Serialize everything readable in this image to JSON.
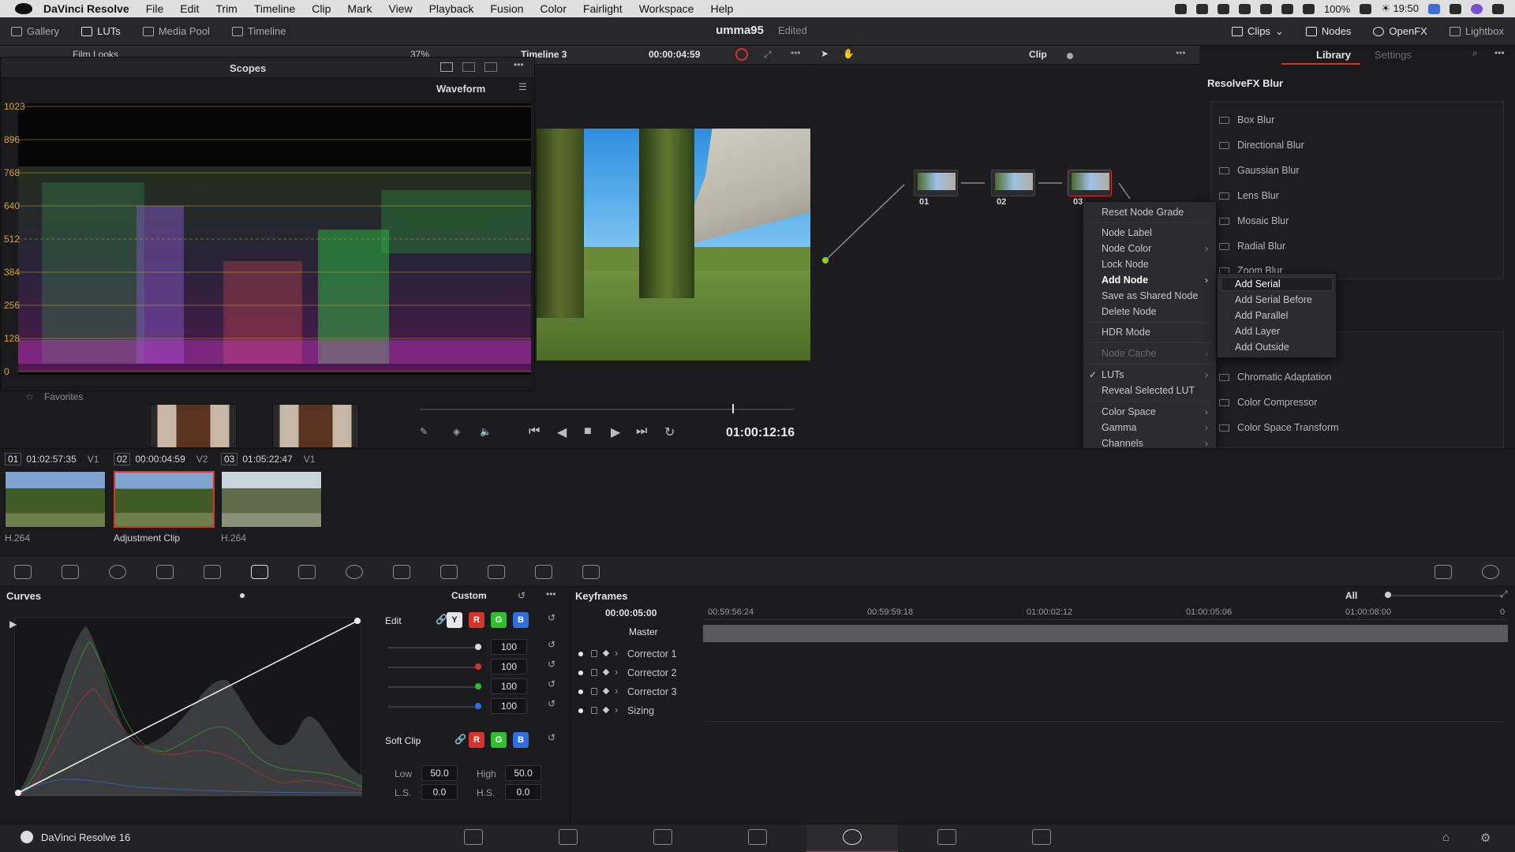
{
  "macmenu": {
    "app": "DaVinci Resolve",
    "items": [
      "File",
      "Edit",
      "Trim",
      "Timeline",
      "Clip",
      "Mark",
      "View",
      "Playback",
      "Fusion",
      "Color",
      "Fairlight",
      "Workspace",
      "Help"
    ],
    "battery": "100%",
    "time": "☀ 19:50"
  },
  "toolbar": {
    "gallery": "Gallery",
    "luts": "LUTs",
    "media_pool": "Media Pool",
    "timeline": "Timeline",
    "project": "umma95",
    "status": "Edited",
    "clips": "Clips",
    "nodes": "Nodes",
    "openfx": "OpenFX",
    "lightbox": "Lightbox"
  },
  "viewer_bar": {
    "album": "Film Looks",
    "zoom": "37%",
    "timeline_name": "Timeline 3",
    "timecode": "00:00:04:59",
    "mode": "Clip"
  },
  "scopes": {
    "title": "Scopes",
    "type": "Waveform",
    "y_labels": [
      "1023",
      "896",
      "768",
      "640",
      "512",
      "384",
      "256",
      "128",
      "0"
    ]
  },
  "gallery": {
    "favorites": "Favorites"
  },
  "transport": {
    "timecode": "01:00:12:16"
  },
  "clips": [
    {
      "num": "01",
      "tc": "01:02:57:35",
      "track": "V1",
      "label": "H.264"
    },
    {
      "num": "02",
      "tc": "00:00:04:59",
      "track": "V2",
      "label": "Adjustment Clip"
    },
    {
      "num": "03",
      "tc": "01:05:22:47",
      "track": "V1",
      "label": "H.264"
    }
  ],
  "nodes": [
    {
      "label": "01"
    },
    {
      "label": "02"
    },
    {
      "label": "03"
    }
  ],
  "context_menu": {
    "items": [
      {
        "label": "Reset Node Grade",
        "state": "normal",
        "submenu": false,
        "checked": false
      },
      {
        "label": "Node Label",
        "state": "normal",
        "submenu": false,
        "checked": false
      },
      {
        "label": "Node Color",
        "state": "normal",
        "submenu": true,
        "checked": false
      },
      {
        "label": "Lock Node",
        "state": "normal",
        "submenu": false,
        "checked": false
      },
      {
        "label": "Add Node",
        "state": "highlight",
        "submenu": true,
        "checked": false
      },
      {
        "label": "Save as Shared Node",
        "state": "normal",
        "submenu": false,
        "checked": false
      },
      {
        "label": "Delete Node",
        "state": "normal",
        "submenu": false,
        "checked": false
      },
      {
        "label": "HDR Mode",
        "state": "normal",
        "submenu": false,
        "checked": false
      },
      {
        "label": "Node Cache",
        "state": "disabled",
        "submenu": true,
        "checked": false
      },
      {
        "label": "LUTs",
        "state": "normal",
        "submenu": true,
        "checked": true
      },
      {
        "label": "Reveal Selected LUT",
        "state": "normal",
        "submenu": false,
        "checked": false
      },
      {
        "label": "Color Space",
        "state": "normal",
        "submenu": true,
        "checked": false
      },
      {
        "label": "Gamma",
        "state": "normal",
        "submenu": true,
        "checked": false
      },
      {
        "label": "Channels",
        "state": "normal",
        "submenu": true,
        "checked": false
      }
    ]
  },
  "submenu": {
    "items": [
      "Add Serial",
      "Add Serial Before",
      "Add Parallel",
      "Add Layer",
      "Add Outside"
    ]
  },
  "library": {
    "tabs": [
      "Library",
      "Settings"
    ],
    "section": "ResolveFX Blur",
    "blur_items": [
      "Box Blur",
      "Directional Blur",
      "Gaussian Blur",
      "Lens Blur",
      "Mosaic Blur",
      "Radial Blur",
      "Zoom Blur"
    ],
    "color_items": [
      "Chromatic Adaptation",
      "Color Compressor",
      "Color Space Transform"
    ]
  },
  "curves": {
    "title": "Curves",
    "preset": "Custom",
    "edit_label": "Edit",
    "channels": [
      {
        "value": "100",
        "color": "#ffffff"
      },
      {
        "value": "100",
        "color": "#e0332c"
      },
      {
        "value": "100",
        "color": "#2fbf2f"
      },
      {
        "value": "100",
        "color": "#2f6fe0"
      }
    ],
    "softclip_label": "Soft Clip",
    "low_label": "Low",
    "low": "50.0",
    "high_label": "High",
    "high": "50.0",
    "ls_label": "L.S.",
    "ls": "0.0",
    "hs_label": "H.S.",
    "hs": "0.0",
    "chips": [
      "Y",
      "R",
      "G",
      "B"
    ]
  },
  "keyframes": {
    "title": "Keyframes",
    "filter": "All",
    "timecode": "00:00:05:00",
    "ruler": [
      "00:59:56:24",
      "00:59:59:18",
      "01:00:02:12",
      "01:00:05:06",
      "01:00:08:00",
      "0"
    ],
    "master": "Master",
    "tracks": [
      "Corrector 1",
      "Corrector 2",
      "Corrector 3",
      "Sizing"
    ]
  },
  "bottom": {
    "app_name": "DaVinci Resolve 16"
  },
  "colors": {
    "accent": "#d8342c",
    "highlight": "#3a6fd6"
  }
}
